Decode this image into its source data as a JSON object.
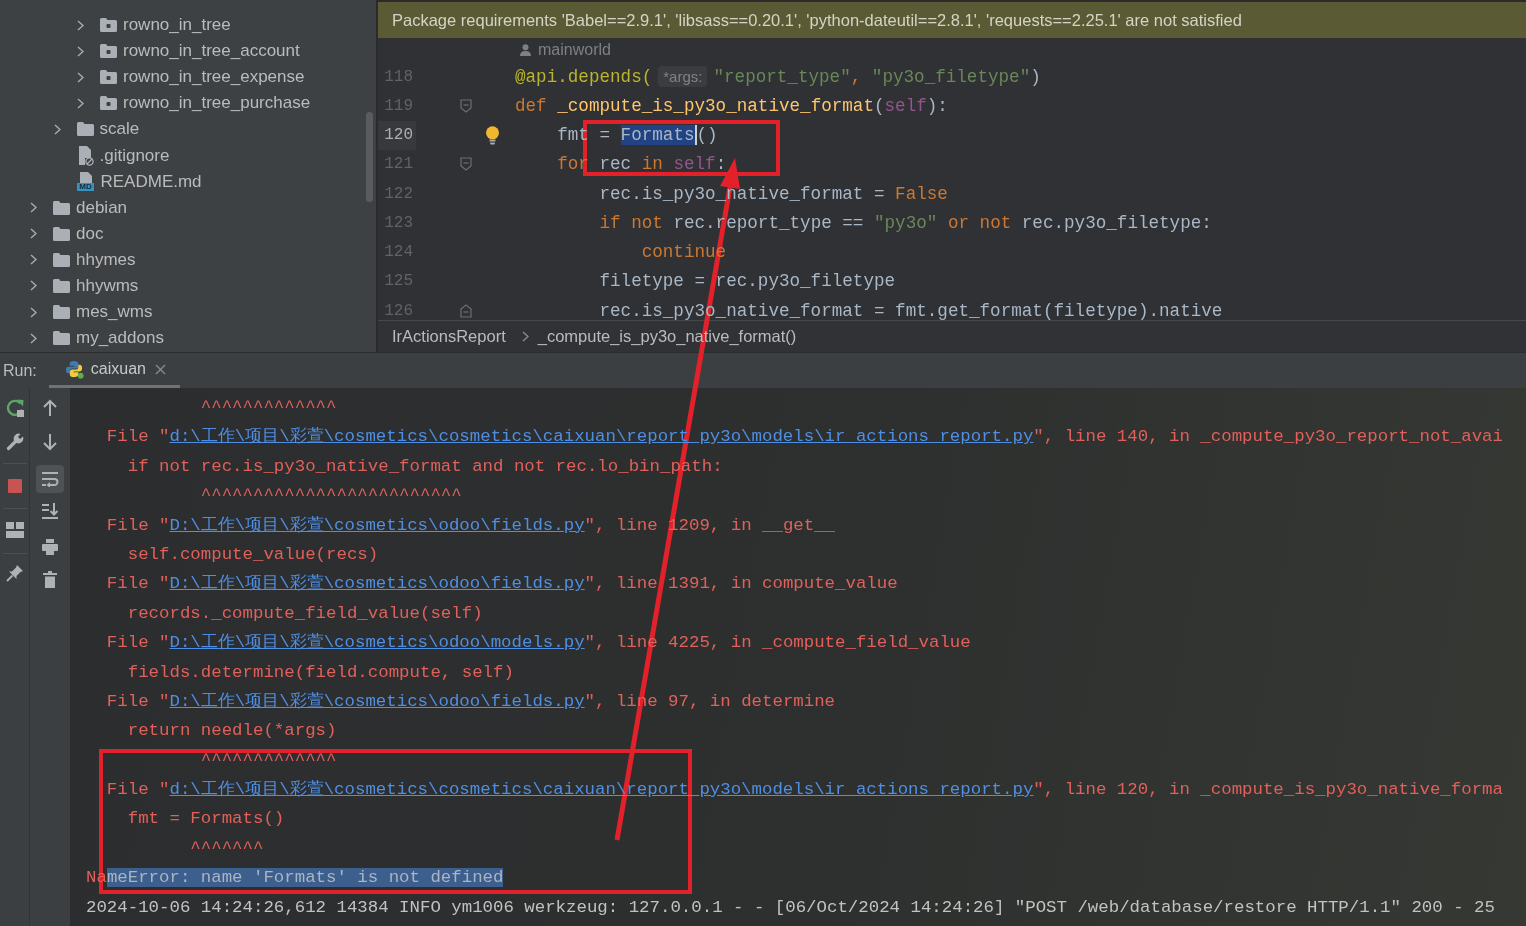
{
  "project_tree": {
    "items": [
      {
        "children": [
          {
            "children": [
              {
                "label": "rowno_in_tree",
                "kind": "module",
                "expanded": false
              },
              {
                "label": "rowno_in_tree_account",
                "kind": "module",
                "expanded": false
              },
              {
                "label": "rowno_in_tree_expense",
                "kind": "module",
                "expanded": false
              },
              {
                "label": "rowno_in_tree_purchase",
                "kind": "module",
                "expanded": false
              }
            ]
          },
          {
            "label": "scale",
            "kind": "folder",
            "expanded": false
          },
          {
            "label": ".gitignore",
            "kind": "ignored_file"
          },
          {
            "label": "README.md",
            "kind": "markdown",
            "badge": "MD"
          }
        ]
      },
      {
        "label": "debian",
        "kind": "folder",
        "expanded": false
      },
      {
        "label": "doc",
        "kind": "folder",
        "expanded": false
      },
      {
        "label": "hhymes",
        "kind": "folder",
        "expanded": false
      },
      {
        "label": "hhywms",
        "kind": "folder",
        "expanded": false
      },
      {
        "label": "mes_wms",
        "kind": "folder",
        "expanded": false
      },
      {
        "label": "my_addons",
        "kind": "folder",
        "expanded": false
      }
    ]
  },
  "editor": {
    "banner": "Package requirements 'Babel==2.9.1', 'libsass==0.20.1', 'python-dateutil==2.8.1', 'requests==2.25.1' are not satisfied",
    "author": "mainworld",
    "lines": [
      {
        "number": "118",
        "kind": "plain",
        "current": false,
        "bulb": false,
        "tokens": [
          {
            "kind": "decorator",
            "text": "@api.depends("
          },
          {
            "kind": "hint",
            "text": "*args:"
          },
          {
            "kind": "string",
            "text": "\"report_type\""
          },
          {
            "kind": "keyword",
            "text": ", "
          },
          {
            "kind": "string",
            "text": "\"py3o_filetype\""
          },
          {
            "kind": "plain",
            "text": ")"
          }
        ]
      },
      {
        "number": "119",
        "kind": "opener",
        "current": false,
        "bulb": false,
        "tokens": [
          {
            "kind": "keyword",
            "text": "def "
          },
          {
            "kind": "function",
            "text": "_compute_is_py3o_native_format"
          },
          {
            "kind": "plain",
            "text": "("
          },
          {
            "kind": "self",
            "text": "self"
          },
          {
            "kind": "plain",
            "text": "):"
          }
        ]
      },
      {
        "number": "120",
        "kind": "plain",
        "current": true,
        "bulb": true,
        "tokens": [
          {
            "kind": "plain",
            "text": "    fmt = "
          },
          {
            "kind": "selected",
            "text": "Formats"
          },
          {
            "kind": "plain",
            "text": "()"
          }
        ]
      },
      {
        "number": "121",
        "kind": "opener",
        "current": false,
        "bulb": false,
        "tokens": [
          {
            "kind": "keyword",
            "text": "    for "
          },
          {
            "kind": "plain",
            "text": "rec "
          },
          {
            "kind": "keyword",
            "text": "in "
          },
          {
            "kind": "self",
            "text": "self"
          },
          {
            "kind": "plain",
            "text": ":"
          }
        ]
      },
      {
        "number": "122",
        "kind": "plain",
        "current": false,
        "bulb": false,
        "tokens": [
          {
            "kind": "plain",
            "text": "        rec.is_py3o_native_format = "
          },
          {
            "kind": "keyword",
            "text": "False"
          }
        ]
      },
      {
        "number": "123",
        "kind": "plain",
        "current": false,
        "bulb": false,
        "tokens": [
          {
            "kind": "keyword",
            "text": "        if not "
          },
          {
            "kind": "plain",
            "text": "rec.report_type == "
          },
          {
            "kind": "string",
            "text": "\"py3o\""
          },
          {
            "kind": "keyword",
            "text": " or not "
          },
          {
            "kind": "plain",
            "text": "rec.py3o_filetype:"
          }
        ]
      },
      {
        "number": "124",
        "kind": "plain",
        "current": false,
        "bulb": false,
        "tokens": [
          {
            "kind": "keyword",
            "text": "            continue"
          }
        ]
      },
      {
        "number": "125",
        "kind": "plain",
        "current": false,
        "bulb": false,
        "tokens": [
          {
            "kind": "plain",
            "text": "        filetype = rec.py3o_filetype"
          }
        ]
      },
      {
        "number": "126",
        "kind": "closer",
        "current": false,
        "bulb": false,
        "tokens": [
          {
            "kind": "plain",
            "text": "        rec.is_py3o_native_format = fmt.get_format(filetype).native"
          }
        ]
      }
    ],
    "breadcrumbs": [
      "IrActionsReport",
      "_compute_is_py3o_native_format()"
    ]
  },
  "run": {
    "label": "Run:",
    "tabs": [
      {
        "label": "caixuan",
        "selected": true
      }
    ],
    "soft_wrap": {
      "on": true
    },
    "console": [
      {
        "tokens": [
          {
            "kind": "error",
            "text": "           ^^^^^^^^^^^^^"
          }
        ]
      },
      {
        "tokens": [
          {
            "kind": "error",
            "text": "  File \""
          },
          {
            "kind": "link",
            "text": "d:\\工作\\项目\\彩萱\\cosmetics\\cosmetics\\caixuan\\report_py3o\\models\\ir_actions_report.py"
          },
          {
            "kind": "error",
            "text": "\", line 140, in _compute_py3o_report_not_avai"
          }
        ]
      },
      {
        "tokens": [
          {
            "kind": "error",
            "text": "    if not rec.is_py3o_native_format and not rec.lo_bin_path:"
          }
        ]
      },
      {
        "tokens": [
          {
            "kind": "error",
            "text": "           ^^^^^^^^^^^^^^^^^^^^^^^^^"
          }
        ]
      },
      {
        "tokens": [
          {
            "kind": "error",
            "text": "  File \""
          },
          {
            "kind": "link",
            "text": "D:\\工作\\项目\\彩萱\\cosmetics\\odoo\\fields.py"
          },
          {
            "kind": "error",
            "text": "\", line 1209, in __get__"
          }
        ]
      },
      {
        "tokens": [
          {
            "kind": "error",
            "text": "    self.compute_value(recs)"
          }
        ]
      },
      {
        "tokens": [
          {
            "kind": "error",
            "text": "  File \""
          },
          {
            "kind": "link",
            "text": "D:\\工作\\项目\\彩萱\\cosmetics\\odoo\\fields.py"
          },
          {
            "kind": "error",
            "text": "\", line 1391, in compute_value"
          }
        ]
      },
      {
        "tokens": [
          {
            "kind": "error",
            "text": "    records._compute_field_value(self)"
          }
        ]
      },
      {
        "tokens": [
          {
            "kind": "error",
            "text": "  File \""
          },
          {
            "kind": "link",
            "text": "D:\\工作\\项目\\彩萱\\cosmetics\\odoo\\models.py"
          },
          {
            "kind": "error",
            "text": "\", line 4225, in _compute_field_value"
          }
        ]
      },
      {
        "tokens": [
          {
            "kind": "error",
            "text": "    fields.determine(field.compute, self)"
          }
        ]
      },
      {
        "tokens": [
          {
            "kind": "error",
            "text": "  File \""
          },
          {
            "kind": "link",
            "text": "D:\\工作\\项目\\彩萱\\cosmetics\\odoo\\fields.py"
          },
          {
            "kind": "error",
            "text": "\", line 97, in determine"
          }
        ]
      },
      {
        "tokens": [
          {
            "kind": "error",
            "text": "    return needle(*args)"
          }
        ]
      },
      {
        "tokens": [
          {
            "kind": "error",
            "text": "           ^^^^^^^^^^^^^"
          }
        ]
      },
      {
        "tokens": [
          {
            "kind": "error",
            "text": "  File \""
          },
          {
            "kind": "link",
            "text": "d:\\工作\\项目\\彩萱\\cosmetics\\cosmetics\\caixuan\\report_py3o\\models\\ir_actions_report.py"
          },
          {
            "kind": "error",
            "text": "\", line 120, in _compute_is_py3o_native_forma"
          }
        ]
      },
      {
        "tokens": [
          {
            "kind": "error",
            "text": "    fmt = Formats()"
          }
        ]
      },
      {
        "tokens": [
          {
            "kind": "error",
            "text": "          ^^^^^^^"
          }
        ]
      },
      {
        "tokens": [
          {
            "kind": "error",
            "text": "Na"
          },
          {
            "kind": "selection",
            "text": "meError: name 'Formats' is not defined"
          }
        ]
      },
      {
        "tokens": [
          {
            "kind": "info",
            "text": "2024-10-06 14:24:26,612 14384 INFO ym1006 werkzeug: 127.0.0.1 - - [06/Oct/2024 14:24:26] \"POST /web/database/restore HTTP/1.1\" 200 - 25"
          }
        ]
      }
    ]
  }
}
